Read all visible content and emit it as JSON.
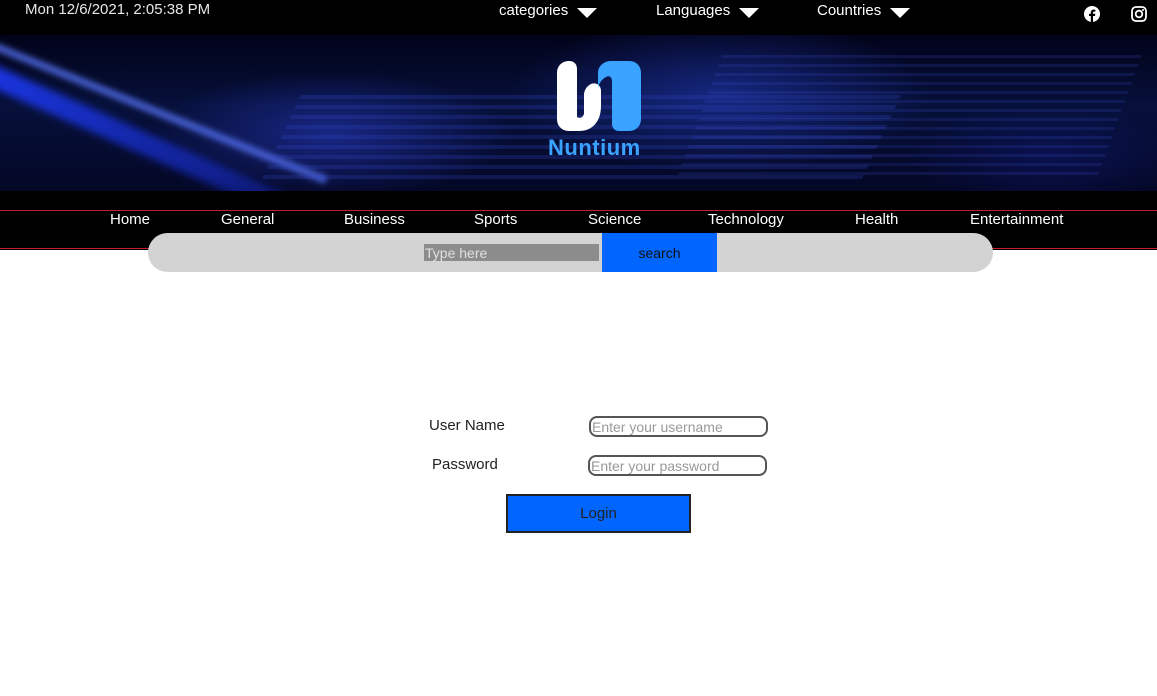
{
  "topbar": {
    "datetime": "Mon 12/6/2021, 2:05:38 PM",
    "dropdowns": [
      {
        "label": "categories"
      },
      {
        "label": "Languages"
      },
      {
        "label": "Countries"
      }
    ],
    "social": [
      "facebook-icon",
      "instagram-icon"
    ]
  },
  "brand": {
    "name": "Nuntium",
    "logo_color": "#3aa3ff"
  },
  "nav": {
    "items": [
      {
        "label": "Home"
      },
      {
        "label": "General"
      },
      {
        "label": "Business"
      },
      {
        "label": "Sports"
      },
      {
        "label": "Science"
      },
      {
        "label": "Technology"
      },
      {
        "label": "Health"
      },
      {
        "label": "Entertainment"
      }
    ]
  },
  "search": {
    "placeholder": "Type here",
    "button_label": "search"
  },
  "login": {
    "username_label": "User Name",
    "username_placeholder": "Enter your username",
    "password_label": "Password",
    "password_placeholder": "Enter your password",
    "button_label": "Login"
  },
  "colors": {
    "accent": "#0066ff",
    "nav_border": "#c41e2a",
    "search_bg": "#d3d3d3"
  }
}
